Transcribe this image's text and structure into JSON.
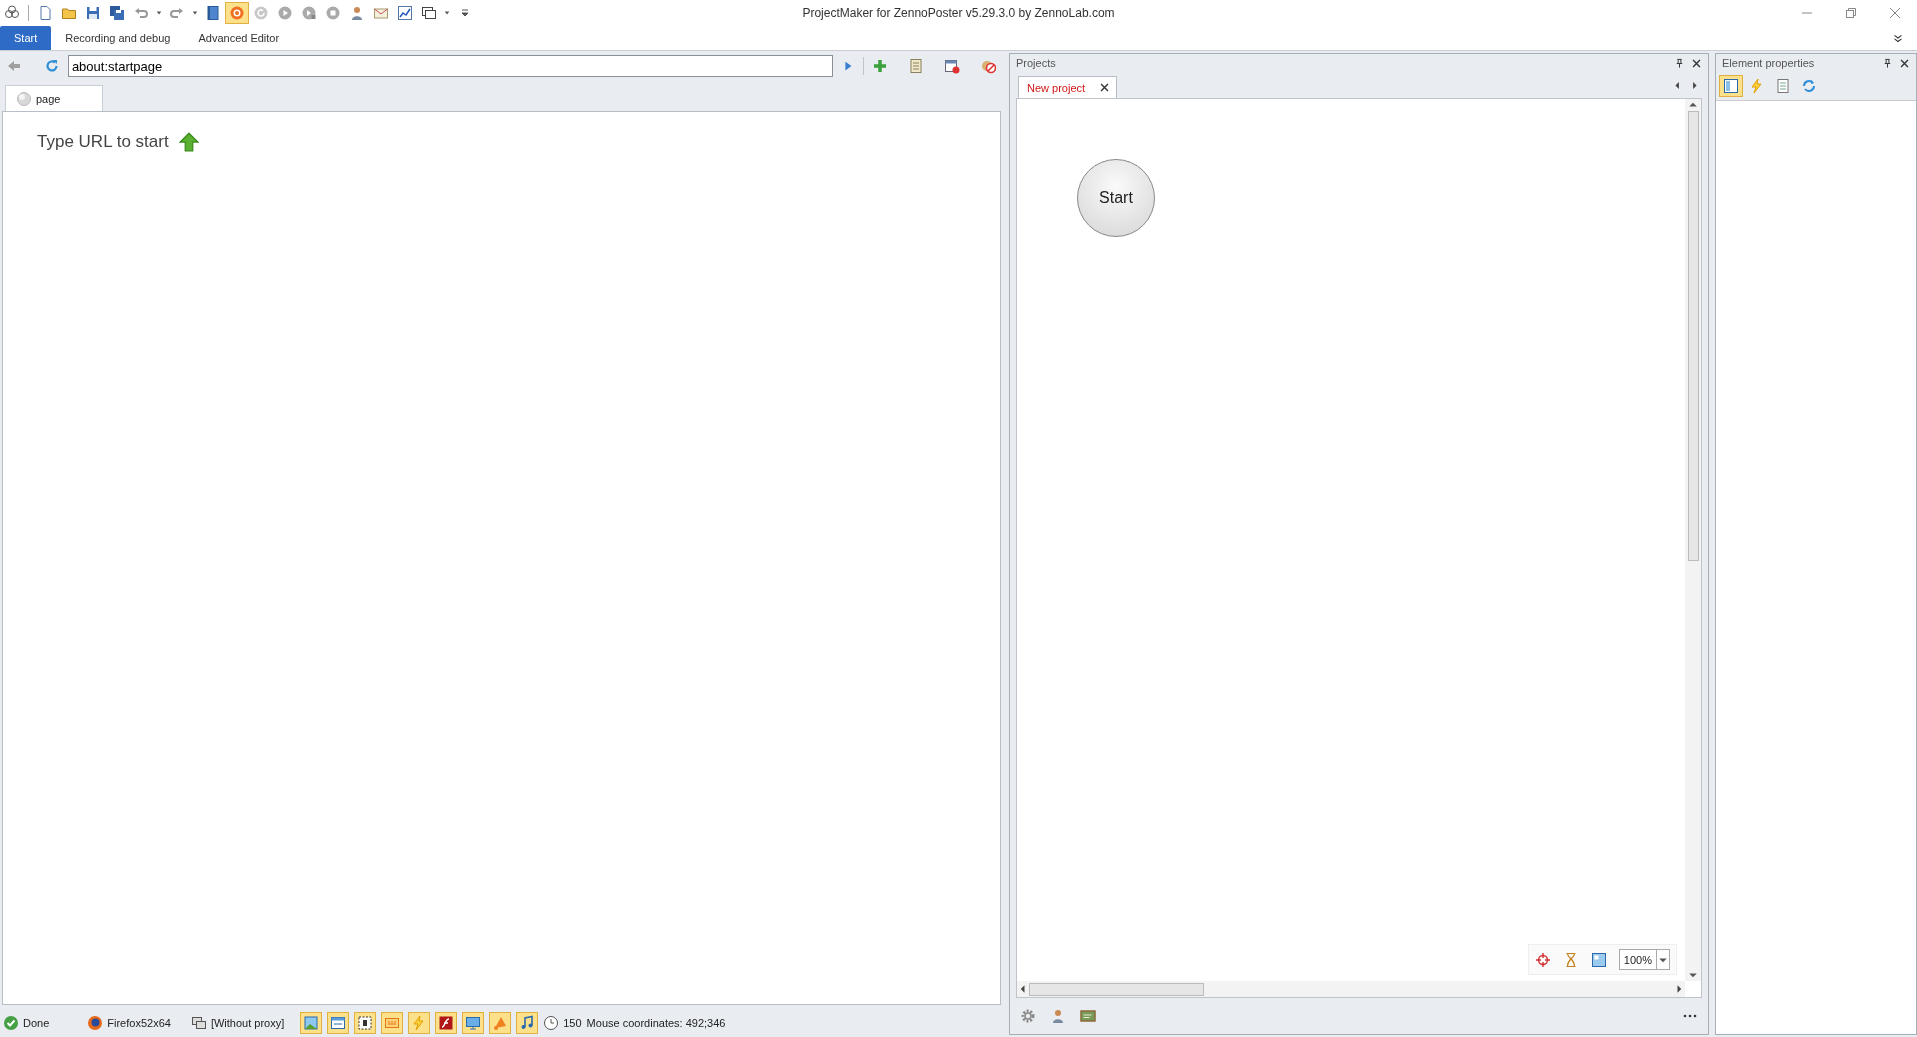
{
  "window": {
    "title": "ProjectMaker for ZennoPoster v5.29.3.0 by ZennoLab.com"
  },
  "toolbar_buttons": [
    {
      "selected": false
    },
    {
      "selected": false
    },
    {
      "selected": false
    },
    {
      "selected": false
    },
    {
      "selected": false
    },
    {
      "selected": false
    },
    {
      "selected": false
    },
    {
      "selected": false
    },
    {
      "selected": true
    },
    {
      "selected": false
    },
    {
      "selected": false
    },
    {
      "selected": false
    },
    {
      "selected": false
    },
    {
      "selected": false
    },
    {
      "selected": false
    },
    {
      "selected": false
    },
    {
      "selected": false
    },
    {
      "selected": false
    }
  ],
  "ribbon_tabs": [
    {
      "label": "Start",
      "selected": true
    },
    {
      "label": "Recording and debug",
      "selected": false
    },
    {
      "label": "Advanced Editor",
      "selected": false
    }
  ],
  "address_bar": {
    "value": "about:startpage"
  },
  "browser_tabs": [
    {
      "label": "page",
      "selected": true
    }
  ],
  "browser_page": {
    "hint": "Type URL to start"
  },
  "projects_panel": {
    "title": "Projects",
    "tabs": [
      {
        "label": "New project",
        "selected": true
      }
    ],
    "start_node": "Start",
    "zoom": "100%"
  },
  "properties_panel": {
    "title": "Element properties",
    "buttons": [
      {
        "selected": true
      },
      {
        "selected": false
      },
      {
        "selected": false
      },
      {
        "selected": false
      }
    ]
  },
  "status_bar": {
    "state": "Done",
    "browser": "Firefox52x64",
    "proxy": "[Without proxy]",
    "toggles": [
      {
        "on": true
      },
      {
        "on": true
      },
      {
        "on": true
      },
      {
        "on": true
      },
      {
        "on": true
      },
      {
        "on": true
      },
      {
        "on": true
      },
      {
        "on": true
      },
      {
        "on": true
      }
    ],
    "threads": "150",
    "mouse": "Mouse coordinates: 492;346"
  }
}
